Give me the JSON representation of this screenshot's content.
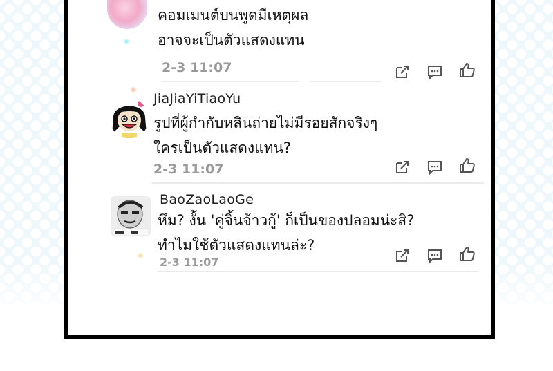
{
  "comments": [
    {
      "username": "",
      "lines": [
        "คอมเมนต์บนพูดมีเหตุผล",
        "อาจจะเป็นตัวแสดงแทน"
      ],
      "date": "2-3 11:07"
    },
    {
      "username": "JiaJiaYiTiaoYu",
      "lines": [
        "รูปที่ผู้กำกับหลินถ่ายไม่มีรอยสักจริงๆ",
        "ใครเป็นตัวแสดงแทน?"
      ],
      "date": "2-3 11:07"
    },
    {
      "username": "BaoZaoLaoGe",
      "lines": [
        "หึม? งั้น 'คู่จิ้นจ้าวกู้' ก็เป็นของปลอมน่ะสิ?",
        "ทำไมใช้ตัวแสดงแทนล่ะ?"
      ],
      "date": "2-3 11:07"
    }
  ],
  "icons": {
    "share": "share-icon",
    "reply": "comment-icon",
    "like": "thumbs-up-icon"
  }
}
